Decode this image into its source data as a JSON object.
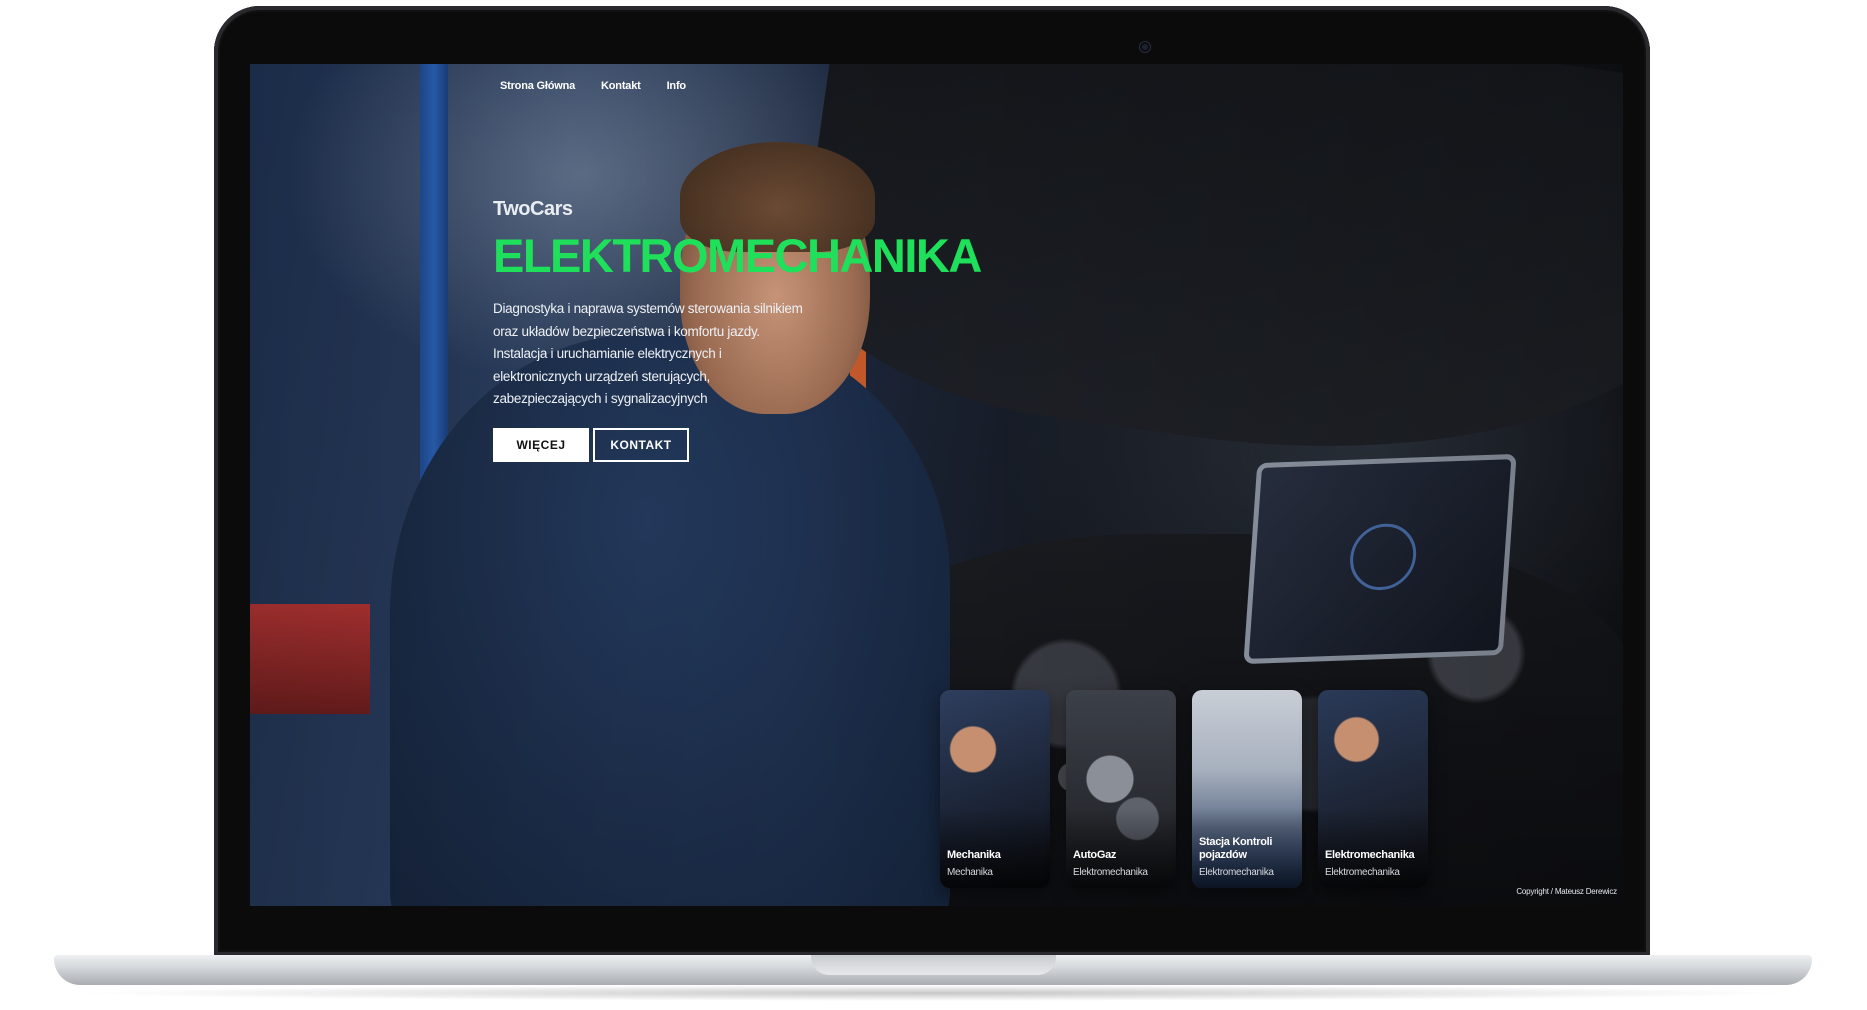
{
  "nav": {
    "items": [
      "Strona Główna",
      "Kontakt",
      "Info"
    ]
  },
  "hero": {
    "brand": "TwoCars",
    "headline": "ELEKTROMECHANIKA",
    "description": "Diagnostyka i naprawa systemów sterowania silnikiem oraz układów bezpieczeństwa i komfortu jazdy. Instalacja i uruchamianie elektrycznych i elektronicznych urządzeń sterujących, zabezpieczających i sygnalizacyjnych",
    "primary_button": "WIĘCEJ",
    "secondary_button": "KONTAKT"
  },
  "carousel": {
    "prev_icon": "‹",
    "next_icon": "›",
    "cards": [
      {
        "title": "Mechanika",
        "subtitle": "Mechanika"
      },
      {
        "title": "AutoGaz",
        "subtitle": "Elektromechanika"
      },
      {
        "title": "Stacja Kontroli pojazdów",
        "subtitle": "Elektromechanika"
      },
      {
        "title": "Elektromechanika",
        "subtitle": "Elektromechanika"
      }
    ]
  },
  "footer": {
    "credit": "Copyright / Mateusz Derewicz"
  },
  "colors": {
    "accent": "#1fe05a",
    "bezel": "#0b0b0c"
  }
}
